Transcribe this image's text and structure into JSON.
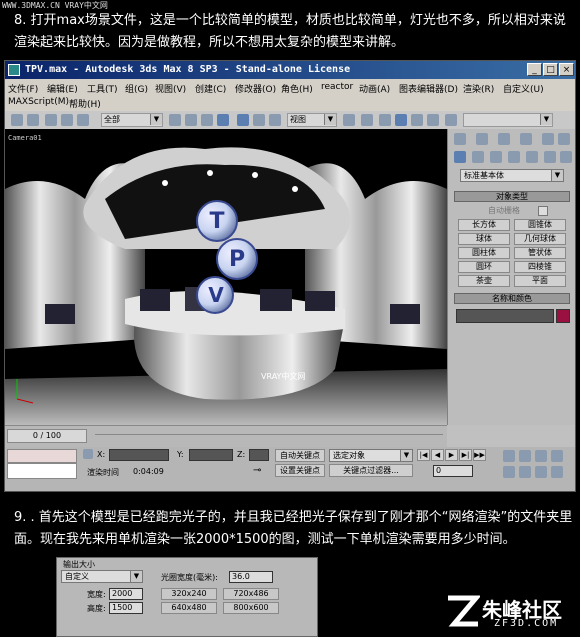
{
  "watermark_top": "WWW.3DMAX.CN VRAY中文网",
  "tutorial": {
    "step8": "8. 打开max场景文件，这是一个比较简单的模型，材质也比较简单，灯光也不多，所以相对来说渲染起来比较快。因为是做教程，所以不想用太复杂的模型来讲解。",
    "step9": "9. . 首先这个模型是已经跑完光子的，并且我已经把光子保存到了刚才那个“网络渲染”的文件夹里面。现在我先来用单机渲染一张2000*1500的图，测试一下单机渲染需要用多少时间。"
  },
  "window": {
    "title": "TPV.max  - Autodesk 3ds Max 8 SP3  - Stand-alone License",
    "minimize": "_",
    "maximize": "□",
    "close": "×"
  },
  "menu": {
    "row1": [
      "文件(F)",
      "编辑(E)",
      "工具(T)",
      "组(G)",
      "视图(V)",
      "创建(C)",
      "修改器(O)",
      "角色(H)",
      "reactor",
      "动画(A)",
      "图表编辑器(D)",
      "渲染(R)",
      "自定义(U)"
    ],
    "row2": [
      "MAXScript(M)",
      "帮助(H)"
    ]
  },
  "toolbar": {
    "selection_filter": "全部",
    "ref_coord": "视图"
  },
  "viewport": {
    "label": "Camera01",
    "scene_text": "VRAY中文网",
    "logo_letters": [
      "T",
      "P",
      "V"
    ]
  },
  "command_panel": {
    "category": "标准基本体",
    "rollout_object_type": "对象类型",
    "autogrid": "自动栅格",
    "buttons": [
      "长方体",
      "圆锥体",
      "球体",
      "几何球体",
      "圆柱体",
      "管状体",
      "圆环",
      "四棱锥",
      "茶壶",
      "平面"
    ],
    "rollout_name_color": "名称和颜色",
    "color": "#9a1040"
  },
  "timebar": {
    "frames": "0 / 100"
  },
  "status": {
    "x_label": "X:",
    "y_label": "Y:",
    "z_label": "Z:",
    "render_time_label": "渲染时间",
    "render_time": "0:04:09",
    "auto_key": "自动关键点",
    "set_key": "设置关键点",
    "selected": "选定对象",
    "key_filters": "关键点过滤器...",
    "frame_value": "0"
  },
  "dialog": {
    "group_title": "输出大小",
    "preset": "自定义",
    "aperture_label": "光圈宽度(毫米):",
    "aperture_value": "36.0",
    "width_label": "宽度:",
    "width_value": "2000",
    "height_label": "高度:",
    "height_value": "1500",
    "sizes": [
      "320x240",
      "720x486",
      "640x480",
      "800x600"
    ]
  },
  "logo": {
    "name": "朱峰社区",
    "url": "ZF3D.COM"
  }
}
